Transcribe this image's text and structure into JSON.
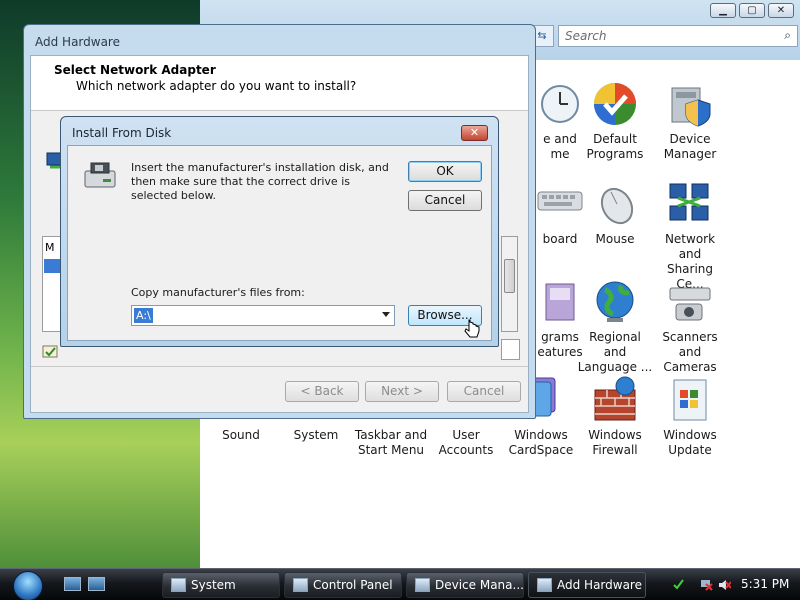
{
  "colors": {
    "accent": "#3a7bd5",
    "close_button": "#c4442d",
    "taskbar": "#15181d"
  },
  "control_panel": {
    "window_buttons": [
      "minimize",
      "maximize",
      "close"
    ],
    "search_placeholder": "Search",
    "items": [
      {
        "label_line1": "e and",
        "label_line2": "me",
        "icon": "clock-icon"
      },
      {
        "label_line1": "Default",
        "label_line2": "Programs",
        "icon": "default-programs-icon"
      },
      {
        "label_line1": "Device",
        "label_line2": "Manager",
        "icon": "device-manager-icon"
      },
      {
        "label_line1": "board",
        "label_line2": "",
        "icon": "keyboard-icon"
      },
      {
        "label_line1": "Mouse",
        "label_line2": "",
        "icon": "mouse-icon"
      },
      {
        "label_line1": "Network and",
        "label_line2": "Sharing Ce...",
        "icon": "network-icon"
      },
      {
        "label_line1": "grams",
        "label_line2": "eatures",
        "icon": "programs-icon"
      },
      {
        "label_line1": "Regional and",
        "label_line2": "Language ...",
        "icon": "globe-icon"
      },
      {
        "label_line1": "Scanners and",
        "label_line2": "Cameras",
        "icon": "scanner-icon"
      },
      {
        "label_line1": "Sound",
        "label_line2": "",
        "icon": "sound-icon"
      },
      {
        "label_line1": "System",
        "label_line2": "",
        "icon": "system-icon"
      },
      {
        "label_line1": "Taskbar and",
        "label_line2": "Start Menu",
        "icon": "taskbar-icon"
      },
      {
        "label_line1": "User",
        "label_line2": "Accounts",
        "icon": "users-icon"
      },
      {
        "label_line1": "Windows",
        "label_line2": "CardSpace",
        "icon": "cardspace-icon"
      },
      {
        "label_line1": "Windows",
        "label_line2": "Firewall",
        "icon": "firewall-icon"
      },
      {
        "label_line1": "Windows",
        "label_line2": "Update",
        "icon": "update-icon"
      }
    ]
  },
  "wizard": {
    "title": "Add Hardware",
    "heading": "Select Network Adapter",
    "subheading": "Which network adapter do you want to install?",
    "list_first_row": "M",
    "buttons": {
      "back": "< Back",
      "next": "Next >",
      "cancel": "Cancel"
    }
  },
  "dialog": {
    "title": "Install From Disk",
    "close": "✕",
    "message": "Insert the manufacturer's installation disk, and then make sure that the correct drive is selected below.",
    "ok": "OK",
    "cancel": "Cancel",
    "copy_label": "Copy manufacturer's files from:",
    "path_value": "A:\\",
    "browse": "Browse..."
  },
  "taskbar": {
    "buttons": [
      {
        "label": "System",
        "icon": "system-icon"
      },
      {
        "label": "Control Panel",
        "icon": "control-panel-icon"
      },
      {
        "label": "Device Mana...",
        "icon": "device-manager-icon"
      },
      {
        "label": "Add Hardware",
        "icon": "add-hardware-icon",
        "active": true
      }
    ],
    "clock": "5:31 PM"
  }
}
